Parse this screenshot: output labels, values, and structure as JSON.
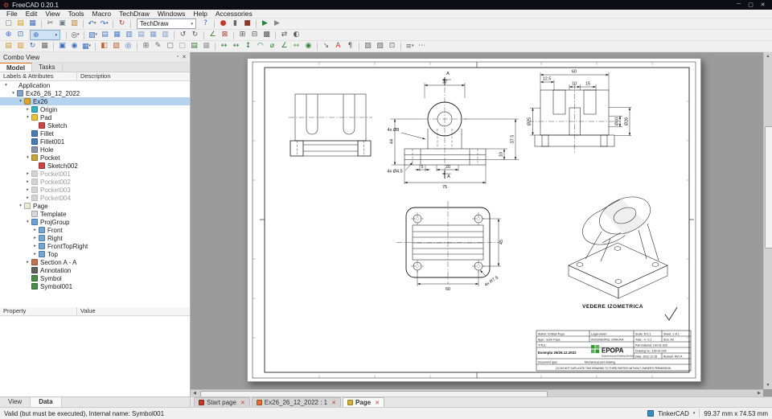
{
  "window": {
    "title": "FreeCAD 0.20.1"
  },
  "icons": {
    "app": "⚙",
    "minimize": "─",
    "maximize": "▢",
    "close": "✕",
    "caret": "▾",
    "float": "▫",
    "panel_close": "✕",
    "zoom": "⊕",
    "scroll_up": "▲",
    "scroll_down": "▼",
    "scroll_left": "◀",
    "scroll_right": "▶"
  },
  "menus": [
    {
      "name": "menu-file",
      "label": "File"
    },
    {
      "name": "menu-edit",
      "label": "Edit"
    },
    {
      "name": "menu-view",
      "label": "View"
    },
    {
      "name": "menu-tools",
      "label": "Tools"
    },
    {
      "name": "menu-macro",
      "label": "Macro"
    },
    {
      "name": "menu-techdraw",
      "label": "TechDraw"
    },
    {
      "name": "menu-windows",
      "label": "Windows"
    },
    {
      "name": "menu-help",
      "label": "Help"
    },
    {
      "name": "menu-accessories",
      "label": "Accessories"
    }
  ],
  "workbench_selector": "TechDraw",
  "toolbars": {
    "row1a": [
      {
        "name": "new-document-icon",
        "g": "▢",
        "c": "#777777"
      },
      {
        "name": "open-file-icon",
        "g": "▤",
        "c": "#d3982a"
      },
      {
        "name": "save-file-icon",
        "g": "▦",
        "c": "#3f6fb5"
      },
      {
        "sep": true,
        "g": ""
      },
      {
        "name": "cut-icon",
        "g": "✂",
        "c": "#555555"
      },
      {
        "name": "copy-icon",
        "g": "▣",
        "c": "#6b7b8d"
      },
      {
        "name": "paste-icon",
        "g": "▥",
        "c": "#c07a2a"
      },
      {
        "sep": true,
        "g": ""
      },
      {
        "name": "undo-icon",
        "g": "↶",
        "c": "#3a6cc0",
        "caret": true
      },
      {
        "name": "redo-icon",
        "g": "↷",
        "c": "#3a6cc0",
        "caret": true
      },
      {
        "sep": true,
        "g": ""
      },
      {
        "name": "refresh-icon",
        "g": "↻",
        "c": "#c2392a"
      },
      {
        "sep": true,
        "g": ""
      }
    ],
    "row1b": [
      {
        "name": "whats-this-icon",
        "g": "?",
        "c": "#3a6cc0"
      },
      {
        "sep": true,
        "g": ""
      },
      {
        "name": "macro-record-icon",
        "g": "●",
        "c": "#c2392a"
      },
      {
        "name": "macro-pause-icon",
        "g": "▮",
        "c": "#666666"
      },
      {
        "name": "macro-stop-icon",
        "g": "■",
        "c": "#8a3a2a"
      },
      {
        "sep": true,
        "g": ""
      },
      {
        "name": "macro-execute-icon",
        "g": "▶",
        "c": "#2e7d32"
      },
      {
        "name": "macro-debug-icon",
        "g": "▶",
        "c": "#888888"
      }
    ],
    "row2a": [
      {
        "name": "fit-all-icon",
        "g": "⊕",
        "c": "#3a6cc0"
      },
      {
        "name": "fit-selection-icon",
        "g": "⊡",
        "c": "#3a6cc0"
      }
    ],
    "row2b": [
      {
        "sep": true,
        "g": ""
      },
      {
        "name": "draw-style-icon",
        "g": "◎",
        "c": "#555555",
        "caret": true
      },
      {
        "sep": true,
        "g": ""
      },
      {
        "name": "view-isometric-icon",
        "g": "▧",
        "c": "#3a6cc0",
        "caret": true
      },
      {
        "name": "view-front-icon",
        "g": "▤",
        "c": "#4a7cc8"
      },
      {
        "name": "view-top-icon",
        "g": "▦",
        "c": "#4a7cc8"
      },
      {
        "name": "view-right-icon",
        "g": "▥",
        "c": "#4a7cc8"
      },
      {
        "name": "view-rear-icon",
        "g": "▤",
        "c": "#7a9cc8"
      },
      {
        "name": "view-bottom-icon",
        "g": "▦",
        "c": "#7a9cc8"
      },
      {
        "name": "view-left-icon",
        "g": "▥",
        "c": "#7a9cc8"
      },
      {
        "sep": true,
        "g": ""
      },
      {
        "name": "rotate-left-icon",
        "g": "↺",
        "c": "#555555"
      },
      {
        "name": "rotate-right-icon",
        "g": "↻",
        "c": "#555555"
      },
      {
        "sep": true,
        "g": ""
      },
      {
        "name": "measure-distance-icon",
        "g": "∠",
        "c": "#2e7d32"
      },
      {
        "name": "clear-measurement-icon",
        "g": "⊠",
        "c": "#a33a2a"
      },
      {
        "sep": true,
        "g": ""
      },
      {
        "name": "box-selection-icon",
        "g": "⊞",
        "c": "#555555"
      },
      {
        "name": "box-element-selection-icon",
        "g": "⊟",
        "c": "#555555"
      },
      {
        "name": "select-all-icon",
        "g": "▩",
        "c": "#555555"
      },
      {
        "sep": true,
        "g": ""
      },
      {
        "name": "tree-sync-icon",
        "g": "⇄",
        "c": "#555555"
      },
      {
        "name": "appearance-icon",
        "g": "◐",
        "c": "#555555"
      }
    ],
    "row3": [
      {
        "name": "new-default-page-icon",
        "g": "▤",
        "c": "#d3982a"
      },
      {
        "name": "new-page-from-template-icon",
        "g": "▥",
        "c": "#d3982a"
      },
      {
        "name": "redraw-page-icon",
        "g": "↻",
        "c": "#3a6cc0"
      },
      {
        "name": "print-all-pages-icon",
        "g": "▦",
        "c": "#666666"
      },
      {
        "sep": true,
        "g": ""
      },
      {
        "name": "insert-view-icon",
        "g": "▣",
        "c": "#3a6cc0"
      },
      {
        "name": "insert-active-view-icon",
        "g": "◉",
        "c": "#3a6cc0"
      },
      {
        "name": "insert-projection-group-icon",
        "g": "▦",
        "c": "#3a6cc0",
        "caret": true
      },
      {
        "sep": true,
        "g": ""
      },
      {
        "name": "section-view-icon",
        "g": "◧",
        "c": "#c0622a"
      },
      {
        "name": "complex-section-icon",
        "g": "▨",
        "c": "#c0622a"
      },
      {
        "name": "detail-view-icon",
        "g": "◎",
        "c": "#3a6cc0"
      },
      {
        "sep": true,
        "g": ""
      },
      {
        "name": "clip-group-icon",
        "g": "⊞",
        "c": "#666666"
      },
      {
        "name": "insert-symbol-icon",
        "g": "✎",
        "c": "#666666"
      },
      {
        "name": "insert-draft-view-icon",
        "g": "▢",
        "c": "#666666"
      },
      {
        "name": "insert-arch-view-icon",
        "g": "▢",
        "c": "#999999"
      },
      {
        "name": "insert-spreadsheet-view-icon",
        "g": "▤",
        "c": "#2e7d32"
      },
      {
        "name": "insert-image-icon",
        "g": "▦",
        "c": "#999999"
      },
      {
        "sep": true,
        "g": ""
      },
      {
        "name": "dimension-length-icon",
        "g": "↔",
        "c": "#2e7d32"
      },
      {
        "name": "dimension-horizontal-icon",
        "g": "↔",
        "c": "#2e7d32"
      },
      {
        "name": "dimension-vertical-icon",
        "g": "↕",
        "c": "#2e7d32"
      },
      {
        "name": "dimension-radius-icon",
        "g": "◠",
        "c": "#2e7d32"
      },
      {
        "name": "dimension-diameter-icon",
        "g": "⌀",
        "c": "#2e7d32"
      },
      {
        "name": "dimension-angle-icon",
        "g": "∠",
        "c": "#2e7d32"
      },
      {
        "name": "dimension-extent-icon",
        "g": "↔",
        "c": "#6a9a6a"
      },
      {
        "name": "balloon-icon",
        "g": "◉",
        "c": "#2e7d32"
      },
      {
        "sep": true,
        "g": ""
      },
      {
        "name": "leader-line-icon",
        "g": "↘",
        "c": "#666666"
      },
      {
        "name": "annotation-tool-icon",
        "g": "A",
        "c": "#c2392a"
      },
      {
        "name": "rich-text-annotation-icon",
        "g": "¶",
        "c": "#666666"
      },
      {
        "sep": true,
        "g": ""
      },
      {
        "name": "hatch-region-icon",
        "g": "▨",
        "c": "#666666"
      },
      {
        "name": "geometric-hatch-icon",
        "g": "▧",
        "c": "#666666"
      },
      {
        "name": "toggle-frames-icon",
        "g": "⊡",
        "c": "#666666"
      },
      {
        "sep": true,
        "g": ""
      },
      {
        "name": "stack-group-icon",
        "g": "≡",
        "c": "#666666",
        "caret": true
      },
      {
        "name": "customize-icon",
        "g": "⋯",
        "c": "#666666"
      }
    ]
  },
  "combo_view": {
    "title": "Combo View",
    "tabs": [
      {
        "name": "tab-model",
        "label": "Model",
        "active": true
      },
      {
        "name": "tab-tasks",
        "label": "Tasks"
      }
    ],
    "columns": {
      "labels": "Labels & Attributes",
      "description": "Description"
    },
    "tree": [
      {
        "label": "Application",
        "pad": "3px",
        "arrow": "▾",
        "icon": "application-icon",
        "hideIcon": true
      },
      {
        "label": "Ex26_26_12_2022",
        "pad": "12px",
        "arrow": "▾",
        "icon": "document-icon",
        "color": "#88a4c4"
      },
      {
        "label": "Ex26",
        "pad": "21px",
        "arrow": "▾",
        "icon": "body-icon",
        "color": "#dca62a",
        "selected": true
      },
      {
        "label": "Origin",
        "pad": "30px",
        "arrow": "▸",
        "icon": "origin-icon",
        "color": "#35b0c0"
      },
      {
        "label": "Pad",
        "pad": "30px",
        "arrow": "▾",
        "icon": "pad-icon",
        "color": "#e8c33a"
      },
      {
        "label": "Sketch",
        "pad": "39px",
        "arrow": "",
        "icon": "sketch-icon",
        "color": "#cc4444"
      },
      {
        "label": "Fillet",
        "pad": "30px",
        "arrow": "",
        "icon": "fillet-icon",
        "color": "#4a7ab8"
      },
      {
        "label": "Fillet001",
        "pad": "30px",
        "arrow": "",
        "icon": "fillet-icon",
        "color": "#4a7ab8"
      },
      {
        "label": "Hole",
        "pad": "30px",
        "arrow": "",
        "icon": "hole-icon",
        "color": "#8a94a8"
      },
      {
        "label": "Pocket",
        "pad": "30px",
        "arrow": "▾",
        "icon": "pocket-icon",
        "color": "#c8a43a"
      },
      {
        "label": "Sketch002",
        "pad": "39px",
        "arrow": "",
        "icon": "sketch-icon",
        "color": "#cc4444"
      },
      {
        "label": "Pocket001",
        "pad": "30px",
        "arrow": "▸",
        "icon": "pocket-icon",
        "color": "#b0b0b0",
        "gray": true
      },
      {
        "label": "Pocket002",
        "pad": "30px",
        "arrow": "▸",
        "icon": "pocket-icon",
        "color": "#b0b0b0",
        "gray": true
      },
      {
        "label": "Pocket003",
        "pad": "30px",
        "arrow": "▸",
        "icon": "pocket-icon",
        "color": "#b0b0b0",
        "gray": true
      },
      {
        "label": "Pocket004",
        "pad": "30px",
        "arrow": "▸",
        "icon": "pocket-icon",
        "color": "#b0b0b0",
        "gray": true
      },
      {
        "label": "Page",
        "pad": "21px",
        "arrow": "▾",
        "icon": "page-icon",
        "color": "#eee8d0"
      },
      {
        "label": "Template",
        "pad": "30px",
        "arrow": "",
        "icon": "template-icon",
        "color": "#d8d8e0"
      },
      {
        "label": "ProjGroup",
        "pad": "30px",
        "arrow": "▾",
        "icon": "projection-group-icon",
        "color": "#6aa0d8"
      },
      {
        "label": "Front",
        "pad": "39px",
        "arrow": "▸",
        "icon": "view-icon",
        "color": "#74a6d4"
      },
      {
        "label": "Right",
        "pad": "39px",
        "arrow": "▸",
        "icon": "view-icon",
        "color": "#74a6d4"
      },
      {
        "label": "FrontTopRight",
        "pad": "39px",
        "arrow": "▸",
        "icon": "view-icon",
        "color": "#74a6d4"
      },
      {
        "label": "Top",
        "pad": "39px",
        "arrow": "▸",
        "icon": "view-icon",
        "color": "#74a6d4"
      },
      {
        "label": "Section A - A",
        "pad": "30px",
        "arrow": "▸",
        "icon": "section-view-icon",
        "color": "#c87050"
      },
      {
        "label": "Annotation",
        "pad": "30px",
        "arrow": "",
        "icon": "annotation-icon",
        "color": "#606060"
      },
      {
        "label": "Symbol",
        "pad": "30px",
        "arrow": "",
        "icon": "symbol-icon",
        "color": "#4a8a4a"
      },
      {
        "label": "Symbol001",
        "pad": "30px",
        "arrow": "",
        "icon": "symbol-icon",
        "color": "#4a8a4a"
      }
    ],
    "property_columns": {
      "property": "Property",
      "value": "Value"
    },
    "bottom_tabs": [
      {
        "name": "tab-view",
        "label": "View"
      },
      {
        "name": "tab-data",
        "label": "Data",
        "active": true
      }
    ]
  },
  "document_tabs": [
    {
      "name": "tab-start-page",
      "label": "Start page",
      "close": "✕",
      "iconColor": "#c2392a"
    },
    {
      "name": "tab-document",
      "label": "Ex26_26_12_2022 : 1",
      "close": "✕",
      "iconColor": "#e07030"
    },
    {
      "name": "tab-page",
      "label": "Page",
      "close": "✕",
      "iconColor": "#d3b23a",
      "active": true
    }
  ],
  "status_bar": {
    "message": "Valid (but must be executed), Internal name: Symbol001",
    "nav_style": "TinkerCAD",
    "dimension_readout": "99.37 mm x 74.53 mm"
  },
  "drawing": {
    "dims": {
      "v2_a_top": "A",
      "v2_37": "37",
      "v2_4xd8": "4x Ø8",
      "v2_44": "44",
      "v2_5": "5",
      "v2_20": "20",
      "v2_4xd45": "4x Ø4.5",
      "v2_75": "75",
      "v2_a_bot": "A",
      "v2_10": "10",
      "v2_375": "37.5",
      "v3_60": "60",
      "v3_125": "12.5",
      "v3_10": "10",
      "v3_15": "15",
      "v3_d25": "Ø25",
      "v3_d10": "Ø10",
      "v3_d26": "Ø26",
      "v4_60": "60",
      "v4_45": "45",
      "v4_r75": "4x R7.5"
    },
    "iso_label": "VEDERE IZOMETRICA",
    "titleblock": {
      "author": "Author: Emilian Popa",
      "approver": "Appr.: Sorin Popa",
      "legal_owner": "Legal owner:",
      "company": "ASCENSORUL CRAIOVA",
      "scale": "Scale: M 1:1",
      "sheet": "Sheet: 1 of 1",
      "tolerance": "Toler.: +/- 0.1",
      "size": "Size: A3",
      "title_label": "TITLE:",
      "title": "Exemplu 26/26.12.2022",
      "part_material": "Part material: 100-01-026",
      "drawing_no": "Drawing no.: 100-01-026",
      "date": "Date: 2022-12-26",
      "revision": "Revision: REV A",
      "logo": "EPOPA",
      "logo_tagline": "Engineering and Drafting Services",
      "doc_type_label": "Document type:",
      "doc_type": "Mechanical part drawing",
      "warning": "(X) DO NOT DUPLICATE THIS DRAWING TO THIRD PARTIES WITHOUT OWNER'S PERMISSION."
    }
  }
}
